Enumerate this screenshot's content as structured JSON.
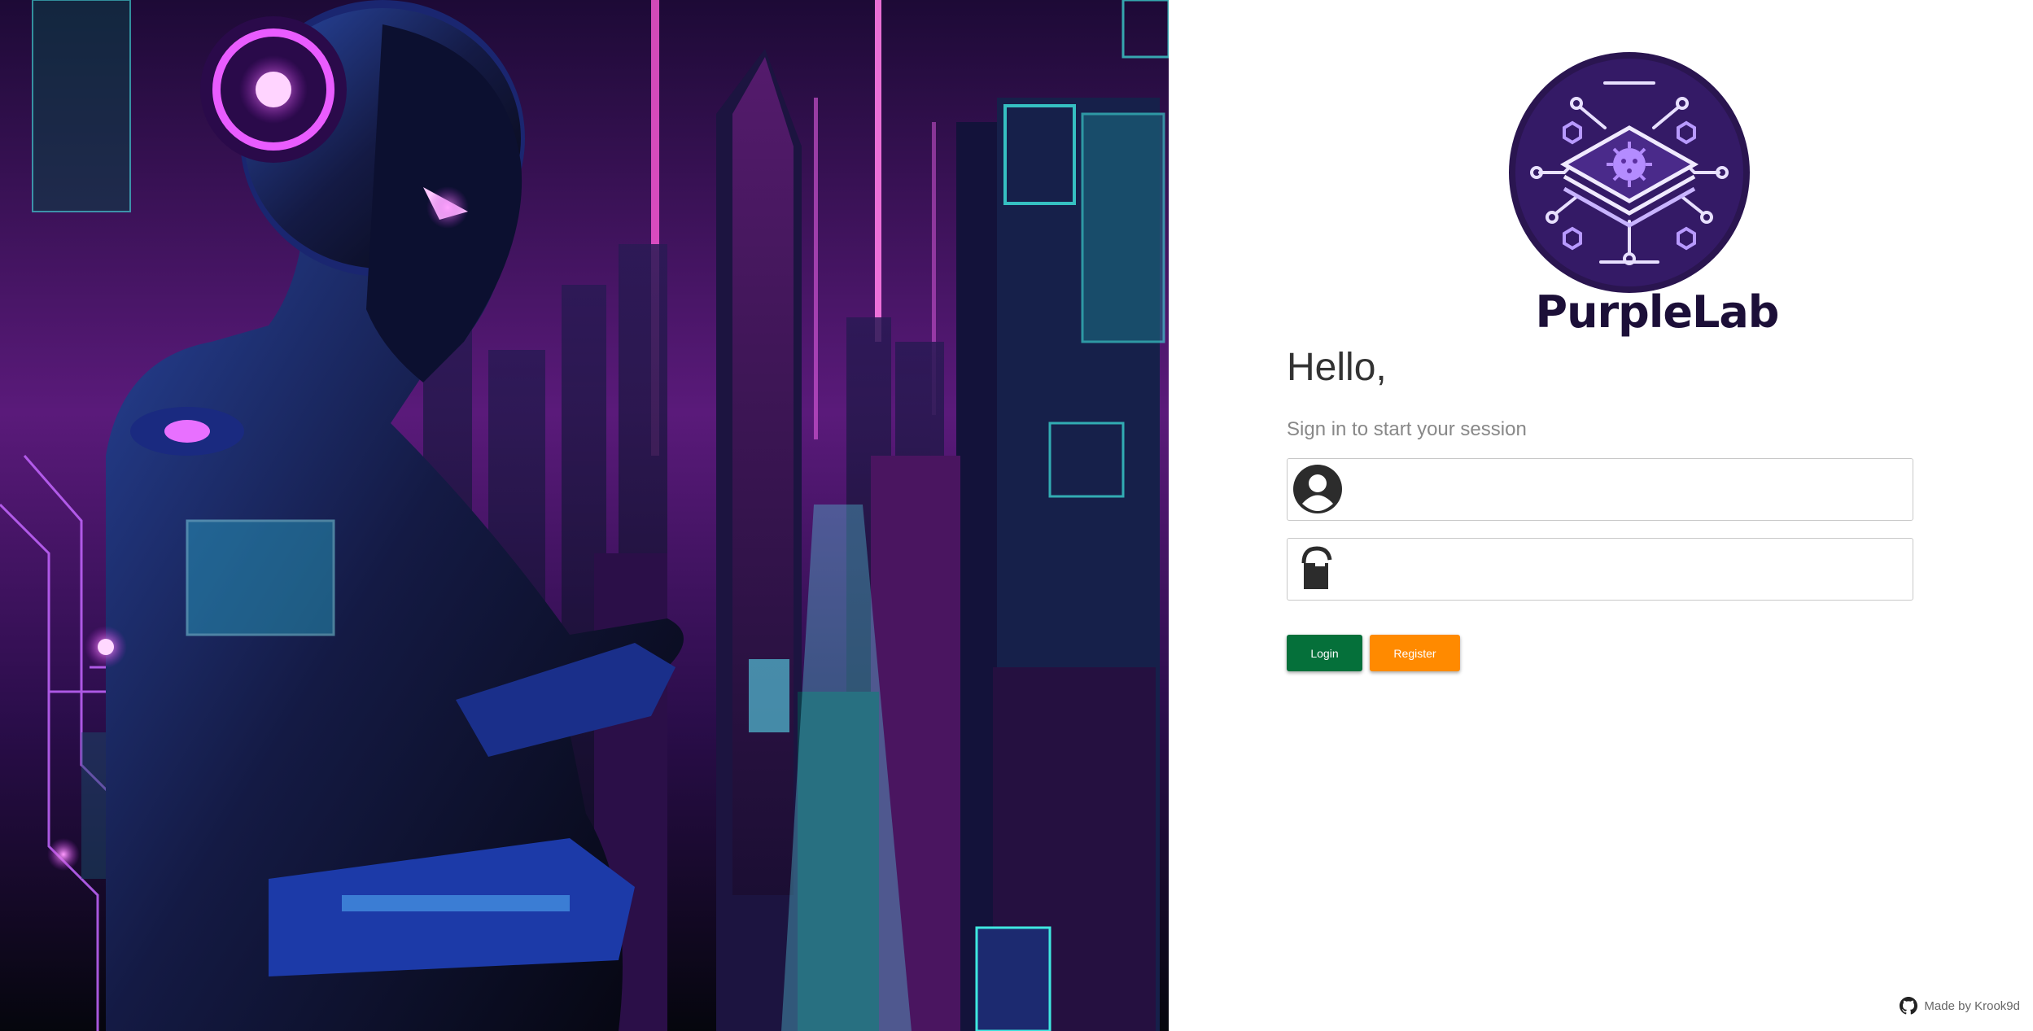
{
  "hero": {
    "image": "cyberpunk-robot-city-illustration"
  },
  "brand": {
    "name": "PurpleLab",
    "logo": "purplelab-logo-icon"
  },
  "form": {
    "greeting": "Hello,",
    "subtitle": "Sign in to start your session",
    "username": {
      "value": "",
      "placeholder": "",
      "icon": "user-icon"
    },
    "password": {
      "value": "",
      "placeholder": "",
      "icon": "lock-icon"
    },
    "login_label": "Login",
    "register_label": "Register"
  },
  "footer": {
    "text": "Made by Krook9d",
    "icon": "github-icon"
  },
  "colors": {
    "login": "#05703a",
    "register": "#ff8a00",
    "brand": "#1c0f38",
    "logo_bg": "#2a1550"
  }
}
